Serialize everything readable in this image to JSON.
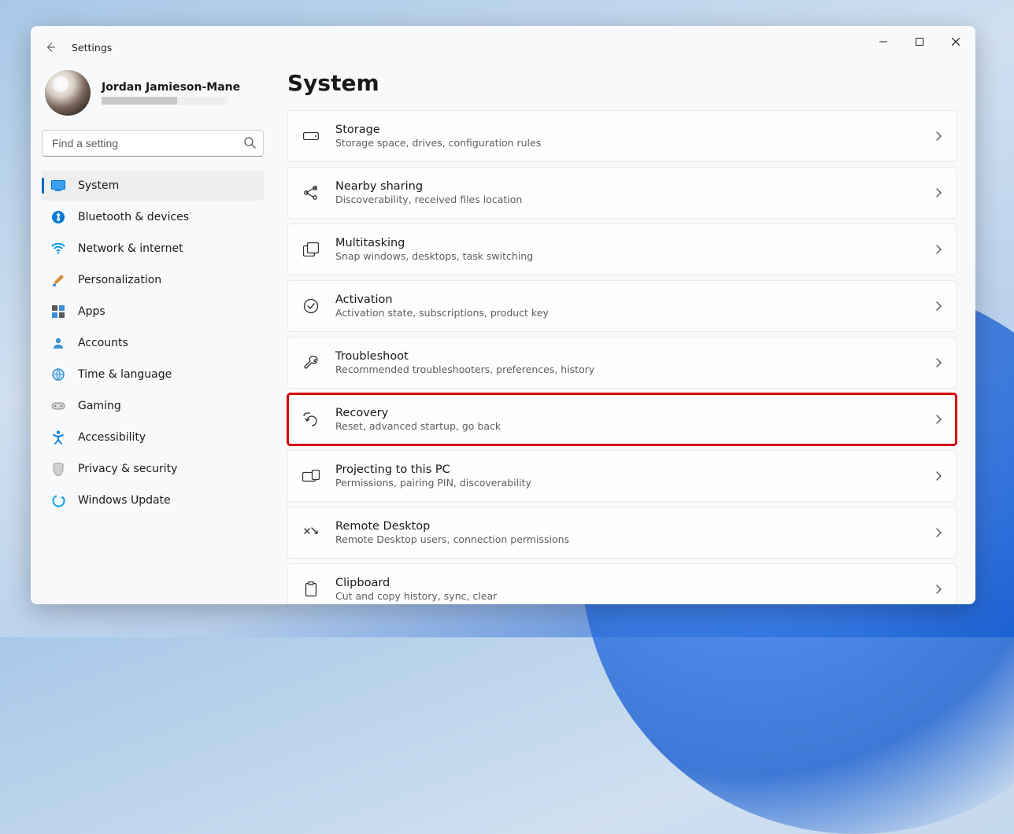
{
  "app_title": "Settings",
  "profile": {
    "name": "Jordan Jamieson-Mane"
  },
  "search": {
    "placeholder": "Find a setting"
  },
  "page_title": "System",
  "nav": [
    {
      "label": "System"
    },
    {
      "label": "Bluetooth & devices"
    },
    {
      "label": "Network & internet"
    },
    {
      "label": "Personalization"
    },
    {
      "label": "Apps"
    },
    {
      "label": "Accounts"
    },
    {
      "label": "Time & language"
    },
    {
      "label": "Gaming"
    },
    {
      "label": "Accessibility"
    },
    {
      "label": "Privacy & security"
    },
    {
      "label": "Windows Update"
    }
  ],
  "cards": [
    {
      "title": "Storage",
      "sub": "Storage space, drives, configuration rules"
    },
    {
      "title": "Nearby sharing",
      "sub": "Discoverability, received files location"
    },
    {
      "title": "Multitasking",
      "sub": "Snap windows, desktops, task switching"
    },
    {
      "title": "Activation",
      "sub": "Activation state, subscriptions, product key"
    },
    {
      "title": "Troubleshoot",
      "sub": "Recommended troubleshooters, preferences, history"
    },
    {
      "title": "Recovery",
      "sub": "Reset, advanced startup, go back"
    },
    {
      "title": "Projecting to this PC",
      "sub": "Permissions, pairing PIN, discoverability"
    },
    {
      "title": "Remote Desktop",
      "sub": "Remote Desktop users, connection permissions"
    },
    {
      "title": "Clipboard",
      "sub": "Cut and copy history, sync, clear"
    }
  ]
}
